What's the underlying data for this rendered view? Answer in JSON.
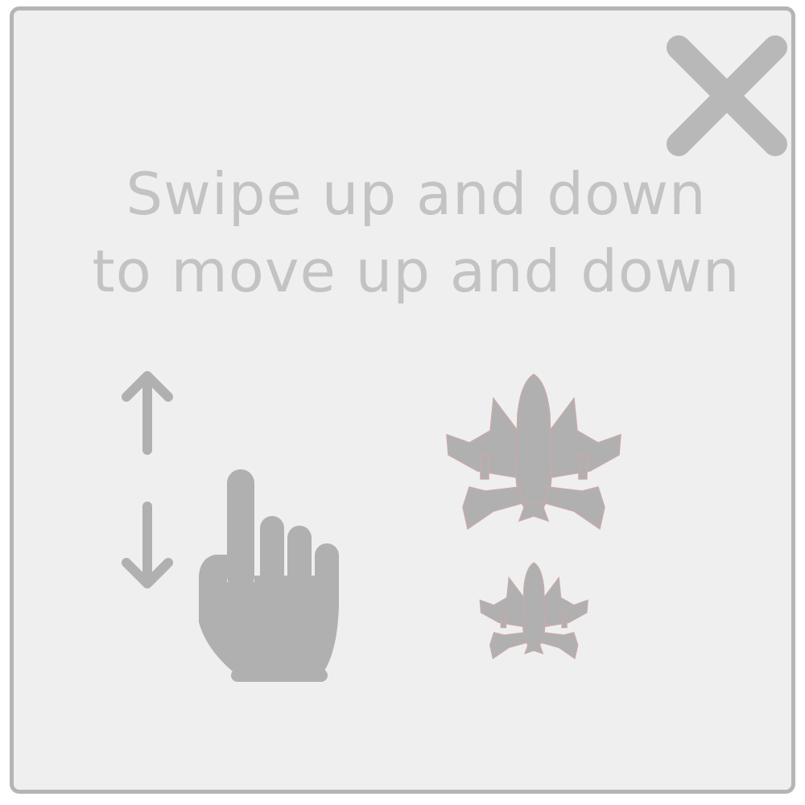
{
  "dialog": {
    "instruction_line1": "Swipe up and down",
    "instruction_line2": "to move up and down",
    "close_icon": "close-icon"
  },
  "illustration": {
    "gesture": {
      "icons": [
        "arrow-up-icon",
        "arrow-down-icon",
        "pointing-hand-icon"
      ]
    },
    "ships": {
      "icons": [
        "spaceship-large-icon",
        "spaceship-small-icon"
      ]
    }
  },
  "colors": {
    "panel_background": "#efefef",
    "panel_border": "#b5b5b5",
    "text": "#c3c3c3",
    "icon": "#b0b0b0",
    "ship_outline": "#c9a9a9"
  }
}
